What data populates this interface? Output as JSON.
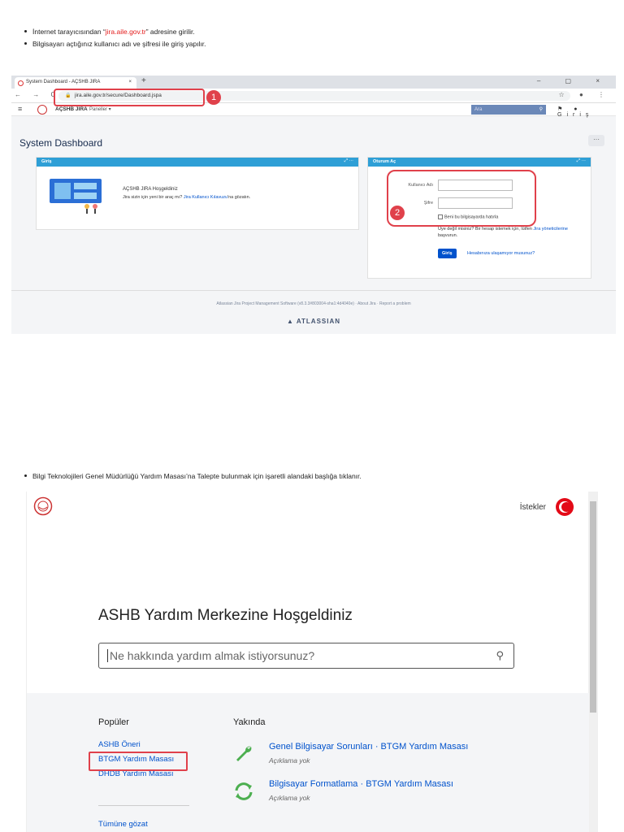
{
  "instructions_top": {
    "line1_pre": "İnternet tarayıcısından “",
    "line1_link": "jira.aile.gov.tr",
    "line1_post": "” adresine girilir.",
    "line2": "Bilgisayarı açtığınız kullanıcı adı ve şifresi ile giriş yapılır."
  },
  "browser": {
    "tab_title": "System Dashboard - AÇSHB JIRA",
    "tab_close": "×",
    "new_tab": "+",
    "url": "jira.aile.gov.tr/secure/Dashboard.jspa",
    "win_controls": "– ▢ ×",
    "nav_icons": "← → C"
  },
  "jira": {
    "app_name": "AÇSHB JIRA",
    "panels_menu": "Paneller ▾",
    "search_placeholder": "Ara",
    "login_link": "Giriş",
    "page_title": "System Dashboard",
    "more_button": "···",
    "intro_gadget": {
      "header": "Giriş",
      "welcome": "AÇSHB JIRA Hoşgeldiniz",
      "text_pre": "Jira sizin için yeni bir araç mı? ",
      "text_link": "Jira Kullanıcı Kılavuzu",
      "text_post": "'na gözatın."
    },
    "login_gadget": {
      "header": "Oturum Aç",
      "username_label": "Kullanıcı Adı",
      "password_label": "Şifre",
      "remember": "Beni bu bilgisayarda hatırla",
      "note_pre": "Üye değil misiniz? Bir hesap istemek için, lütfen ",
      "note_link": "Jira yöneticilerine",
      "note_post": " başvurun.",
      "login_button": "Giriş",
      "cant_access": "Hesabınıza ulaşamıyor musunuz?"
    },
    "footer": "Atlassian Jira Project Management Software (v8.3.3#803004-sha1:4d4040e)  ·  About Jira  ·  Report a problem",
    "footer_brand": "▲ ATLASSIAN"
  },
  "callouts": {
    "one": "1",
    "two": "2"
  },
  "instruction_mid": "Bilgi Teknolojileri Genel Müdürlüğü Yardım Masası’na Talepte bulunmak için işaretli alandaki başlığa tıklanır.",
  "portal": {
    "requests": "İstekler",
    "title": "ASHB Yardım Merkezine Hoşgeldiniz",
    "search_placeholder": "Ne hakkında yardım almak istiyorsunuz?",
    "popular_heading": "Popüler",
    "popular": [
      "ASHB Öneri",
      "BTGM Yardım Masası",
      "DHDB Yardım Masası"
    ],
    "browse_all": "Tümüne gözat",
    "recent_heading": "Yakında",
    "recent": [
      {
        "title": "Genel Bilgisayar Sorunları · BTGM Yardım Masası",
        "desc": "Açıklama yok",
        "icon": "wrench-icon"
      },
      {
        "title": "Bilgisayar Formatlama · BTGM Yardım Masası",
        "desc": "Açıklama yok",
        "icon": "refresh-icon"
      }
    ]
  },
  "colors": {
    "highlight": "#e0414b",
    "jira_blue": "#0052cc",
    "gadget_header": "#2e9fd6"
  }
}
